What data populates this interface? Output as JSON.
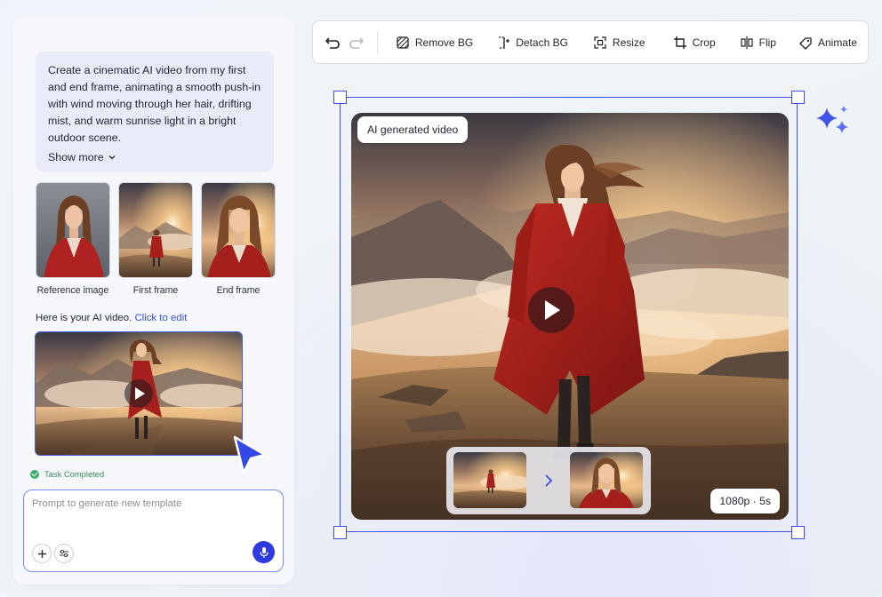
{
  "chat": {
    "prompt": "Create a cinematic AI video from my first and end frame, animating a smooth push-in with wind moving through her hair, drifting mist, and warm sunrise light in a bright outdoor scene.",
    "show_more": "Show more",
    "thumbnails": [
      {
        "label": "Reference image"
      },
      {
        "label": "First frame"
      },
      {
        "label": "End frame"
      }
    ],
    "result_text": "Here is your AI video.",
    "result_link": "Click to edit",
    "status": "Task Completed"
  },
  "composer": {
    "placeholder": "Prompt to generate new template"
  },
  "toolbar": {
    "remove_bg": "Remove BG",
    "detach_bg": "Detach BG",
    "resize": "Resize",
    "crop": "Crop",
    "flip": "Flip",
    "animate": "Animate"
  },
  "canvas": {
    "badge": "AI generated video",
    "resolution": "1080p · 5s"
  },
  "colors": {
    "accent": "#3d4fe0",
    "mic_button": "#2f39e0",
    "link": "#3650e0",
    "status_green": "#3fae6a"
  },
  "icons": [
    "undo-icon",
    "redo-icon",
    "remove-bg-icon",
    "detach-bg-icon",
    "resize-icon",
    "crop-icon",
    "flip-icon",
    "animate-icon",
    "play-icon",
    "sparkle-icon",
    "cursor-icon",
    "plus-icon",
    "settings-sliders-icon",
    "mic-icon",
    "chevron-down-icon",
    "chevron-right-icon",
    "check-circle-icon"
  ]
}
